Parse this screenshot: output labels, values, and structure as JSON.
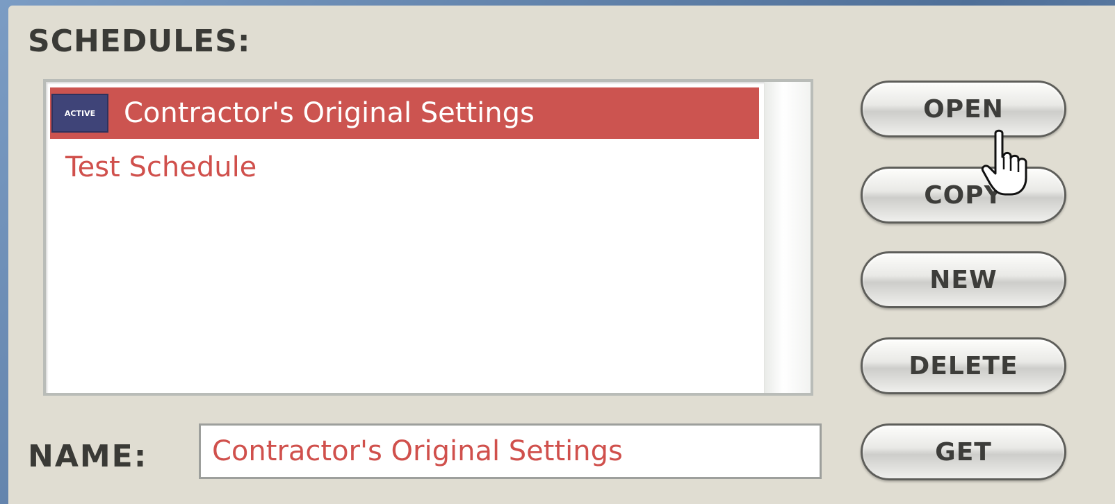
{
  "schedules_heading": "SCHEDULES:",
  "schedule_list": {
    "items": [
      {
        "badge": "ACTIVE",
        "label": "Contractor's Original Settings",
        "selected": true
      },
      {
        "label": "Test Schedule",
        "selected": false
      }
    ]
  },
  "buttons": {
    "open": "OPEN",
    "copy": "COPY",
    "new": "NEW",
    "delete": "DELETE",
    "get": "GET"
  },
  "name_field": {
    "label": "NAME:",
    "value": "Contractor's Original Settings"
  },
  "colors": {
    "panel_bg": "#e0ddd2",
    "selection_bg": "#cc5450",
    "item_text": "#d0504c",
    "active_badge_bg": "#3f4478"
  },
  "icons": {
    "cursor": "hand-pointer-icon",
    "badge": "active-badge-icon"
  }
}
